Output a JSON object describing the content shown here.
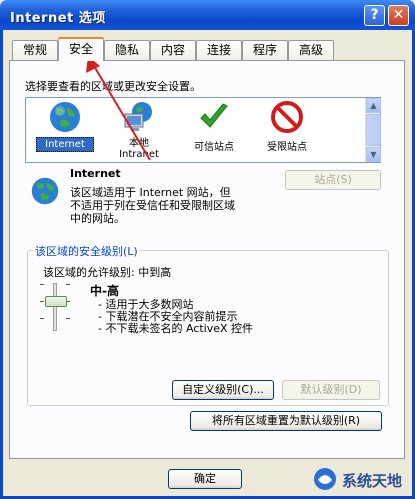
{
  "window": {
    "title": "Internet 选项",
    "help": "?",
    "close": "✕"
  },
  "tabs": [
    "常规",
    "安全",
    "隐私",
    "内容",
    "连接",
    "程序",
    "高级"
  ],
  "instructions": "选择要查看的区域或更改安全设置。",
  "zones": [
    {
      "name": "Internet",
      "icon": "globe-icon"
    },
    {
      "name": "本地\nIntranet",
      "icon": "network-icon"
    },
    {
      "name": "可信站点",
      "icon": "checkmark-icon"
    },
    {
      "name": "受限站点",
      "icon": "restricted-icon"
    }
  ],
  "zone_info": {
    "title": "Internet",
    "description_lines": [
      "该区域适用于 Internet 网站，但",
      "不适用于列在受信任和受限制区域",
      "中的网站。"
    ],
    "sites_button": "站点(S)"
  },
  "security_level": {
    "group_title": "该区域的安全级别(L)",
    "allowed": "该区域的允许级别: 中到高",
    "level_name": "中-高",
    "bullets": [
      "- 适用于大多数网站",
      "- 下载潜在不安全内容前提示",
      "- 不下载未签名的 ActiveX 控件"
    ],
    "custom_button": "自定义级别(C)...",
    "default_button": "默认级别(D)"
  },
  "reset_all_button": "将所有区域重置为默认级别(R)",
  "ok_button": "确定",
  "watermark": "系统天地",
  "colors": {
    "titlebar": "#1f5fd8",
    "selection": "#316ac5",
    "tab_highlight": "#e68b2c",
    "arrow": "#d42020"
  }
}
